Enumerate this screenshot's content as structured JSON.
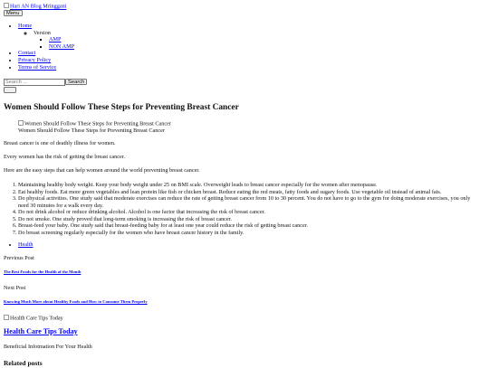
{
  "header": {
    "logo_alt": "Hari AN Blog Mringgani",
    "menu_button": "Menu"
  },
  "nav": {
    "home": "Home",
    "version": "Version",
    "amp": "AMP",
    "non_amp": "NON AMP",
    "contact": "Contact",
    "privacy": "Privacy Policy",
    "terms": "Terms of Service"
  },
  "search": {
    "placeholder": "Search ...",
    "button": "Search"
  },
  "article": {
    "title": "Women Should Follow These Steps for Preventing Breast Cancer",
    "image_alt": "Women Should Follow These Steps for Preventing Breast Cancer",
    "image_caption": "Women Should Follow These Steps for Preventing Breast Cancer",
    "paragraphs": [
      "Breast cancer is one of deathly illness for women.",
      "Every women has the risk of getting the breast cancer.",
      "Here are the easy steps that can help women around the world preventing breast cancer."
    ],
    "steps": [
      "Maintaining healthy body weight. Keep your body weight under 25 on BMI scale. Overweight leads to breast cancer especially for the women after menopause.",
      "Eat healthy foods. Eat more green vegetables and lean protein like fish or chicken breast. Reduce eating the red meats, fatty foods and sugary foods. Use vegetable oil instead of animal fats.",
      "Do physical activities. One study said that moderate exercises can reduce the rate of getting breast cancer from 10 to 30 percent. You do not have to go to the gym for doing moderate exercises, you only need 30 minutes for a walk every day.",
      "Do not drink alcohol or reduce drinking alcohol. Alcohol is one factor that increasing the risk of breast cancer.",
      "Do not smoke. One study proved that long-term smoking is increasing the risk of breast cancer.",
      "Breast-feed your baby. One study said that breast-feeding baby for at least one year could reduce the risk of getting breast cancer.",
      "Do breast screening regularly especially for the women who have breast cancer history in the family."
    ],
    "category": "Health"
  },
  "post_nav": {
    "previous_label": "Previous Post",
    "previous_title": "The Best Foods for the Health of the Month",
    "next_label": "Next Post",
    "next_title": "Knowing Much More about Healthy Foods and How to Consume Them Properly"
  },
  "footer": {
    "image_alt": "Health Care Tips Today",
    "site_title": "Health Care Tips Today",
    "tagline": "Beneficial Infotmation For Your Health",
    "related_heading": "Related posts"
  }
}
